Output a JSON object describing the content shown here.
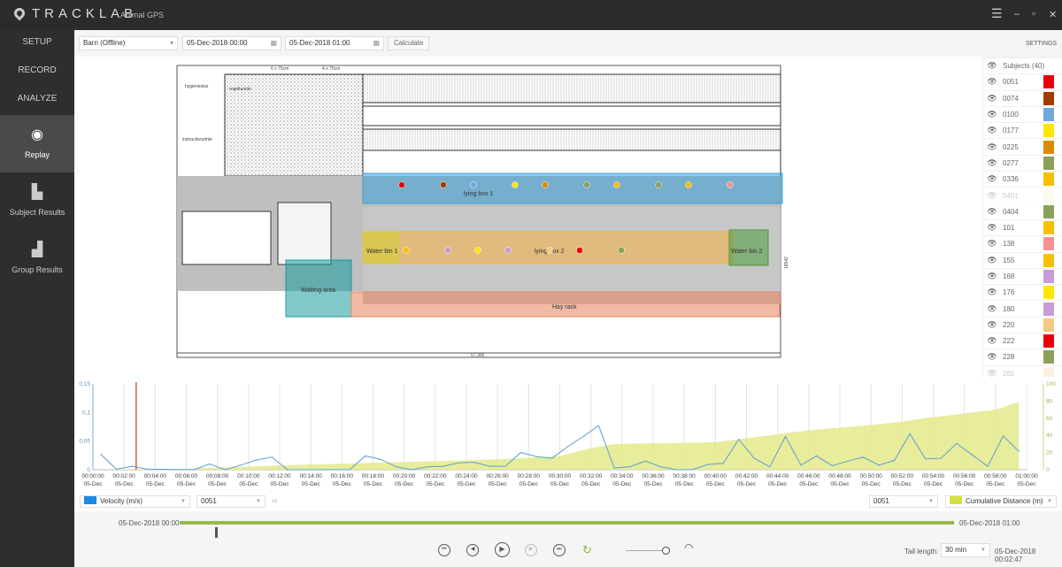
{
  "app": {
    "title": "TRACKLAB",
    "subtitle": "Animal GPS",
    "window_controls": [
      "menu-icon",
      "minimize-icon",
      "restore-icon",
      "close-icon"
    ]
  },
  "sidebar": {
    "items": [
      {
        "label": "SETUP"
      },
      {
        "label": "RECORD"
      },
      {
        "label": "ANALYZE"
      }
    ],
    "tools": [
      {
        "label": "Replay",
        "icon": "replay-icon",
        "active": true
      },
      {
        "label": "Subject Results",
        "icon": "subject-results-icon"
      },
      {
        "label": "Group Results",
        "icon": "group-results-icon"
      }
    ]
  },
  "toolbar": {
    "source": "Barn (Offline)",
    "start": "05-Dec-2018 00:00",
    "end": "05-Dec-2018 01:00",
    "calculate": "Calculate",
    "settings": "SETTINGS"
  },
  "map": {
    "zones": [
      {
        "label": "lying box 1",
        "color": "#3aa0d8"
      },
      {
        "label": "lying box 2",
        "color": "#f5b041"
      },
      {
        "label": "Water bin 1",
        "color": "#d4d030"
      },
      {
        "label": "Water bin 2",
        "color": "#4a9a3a"
      },
      {
        "label": "Waiting area",
        "color": "#1a9aa0"
      },
      {
        "label": "Hay rack",
        "color": "#e8825a"
      }
    ],
    "labels": {
      "room1": "hygieneslus",
      "room2": "regeltumtle",
      "room3": "instructieruimte",
      "dim_top1": "6 x 75cm",
      "dim_top2": "4 x 75cm",
      "dim_bottom": "57,300",
      "dim_right": "18542"
    }
  },
  "subjects": {
    "header": "Subjects (40)",
    "items": [
      {
        "id": "0051",
        "color": "#e8000b"
      },
      {
        "id": "0074",
        "color": "#a33a00"
      },
      {
        "id": "0100",
        "color": "#6fa8dc"
      },
      {
        "id": "0177",
        "color": "#ffe600"
      },
      {
        "id": "0225",
        "color": "#d98c00"
      },
      {
        "id": "0277",
        "color": "#8aa05a"
      },
      {
        "id": "0336",
        "color": "#f5c000"
      },
      {
        "id": "0401",
        "color": "#eef5c8",
        "hidden": true
      },
      {
        "id": "0404",
        "color": "#8aa05a"
      },
      {
        "id": "101",
        "color": "#f5c000"
      },
      {
        "id": "138",
        "color": "#f89090"
      },
      {
        "id": "155",
        "color": "#f5c000"
      },
      {
        "id": "168",
        "color": "#c89ad8"
      },
      {
        "id": "176",
        "color": "#ffe600"
      },
      {
        "id": "180",
        "color": "#c89ad8"
      },
      {
        "id": "220",
        "color": "#f8c880"
      },
      {
        "id": "222",
        "color": "#e8000b"
      },
      {
        "id": "228",
        "color": "#8aa05a"
      },
      {
        "id": "285",
        "color": "#f8d8a0",
        "hidden": true
      }
    ]
  },
  "chart_data": {
    "type": "line",
    "x_ticks": [
      "00:00:00",
      "00:02:00",
      "00:04:00",
      "00:06:00",
      "00:08:00",
      "00:10:00",
      "00:12:00",
      "00:14:00",
      "00:16:00",
      "00:18:00",
      "00:20:00",
      "00:22:00",
      "00:24:00",
      "00:26:00",
      "00:28:00",
      "00:30:00",
      "00:32:00",
      "00:34:00",
      "00:36:00",
      "00:38:00",
      "00:40:00",
      "00:42:00",
      "00:44:00",
      "00:46:00",
      "00:48:00",
      "00:50:00",
      "00:52:00",
      "00:54:00",
      "00:56:00",
      "00:58:00",
      "01:00:00"
    ],
    "x_tick_date": "05-Dec",
    "xlim_minutes": [
      0,
      60
    ],
    "y_left": {
      "ticks": [
        "0",
        "0,05",
        "0,1",
        "0,15"
      ],
      "range": [
        0,
        0.15
      ]
    },
    "y_right": {
      "ticks": [
        "0",
        "20",
        "40",
        "60",
        "80",
        "100"
      ],
      "range": [
        0,
        100
      ]
    },
    "cursor_minute": 2.78,
    "series": [
      {
        "name": "Velocity (m/s)",
        "axis": "left",
        "color": "#5a9fd4",
        "type": "line",
        "x": [
          0.5,
          1.5,
          2.5,
          3.5,
          6.5,
          7.5,
          8.5,
          9.5,
          10.5,
          11.5,
          12.5,
          16.5,
          17.5,
          18.5,
          19.5,
          20.5,
          21.5,
          22.5,
          23.5,
          24.5,
          25.5,
          26.5,
          27.5,
          28.5,
          29.5,
          30.5,
          31.5,
          32.5,
          33.5,
          34.5,
          35.5,
          36.5,
          37.5,
          38.5,
          39.5,
          40.5,
          41.5,
          42.5,
          43.5,
          44.5,
          45.5,
          46.5,
          47.5,
          48.5,
          49.5,
          50.5,
          51.5,
          52.5,
          53.5,
          54.5,
          55.5,
          56.5,
          57.5,
          58.5,
          59.5
        ],
        "y": [
          0.027,
          0.001,
          0.006,
          0.001,
          0,
          0.01,
          0,
          0.008,
          0.017,
          0.022,
          0,
          0,
          0.024,
          0.018,
          0.005,
          0,
          0.005,
          0.006,
          0.012,
          0.013,
          0.006,
          0.006,
          0.03,
          0.023,
          0.02,
          0.04,
          0.058,
          0.077,
          0.003,
          0.005,
          0.015,
          0.005,
          0,
          0,
          0.009,
          0.011,
          0.053,
          0.02,
          0.005,
          0.058,
          0.008,
          0.024,
          0.007,
          0.015,
          0.022,
          0.008,
          0.016,
          0.063,
          0.019,
          0.02,
          0.046,
          0.026,
          0.006,
          0.059,
          0.032
        ]
      },
      {
        "name": "Cumulative Distance (m)",
        "axis": "right",
        "color": "#e4ea8a",
        "type": "area",
        "x": [
          0,
          6,
          12,
          18,
          26,
          30,
          32,
          33.5,
          40,
          43,
          46,
          50,
          52,
          53.5,
          58,
          59.5
        ],
        "y": [
          0,
          1,
          5,
          8,
          12,
          16,
          25,
          30,
          32,
          39,
          46,
          52,
          56,
          60,
          70,
          79
        ]
      }
    ]
  },
  "chart_controls": {
    "left_metric": "Velocity (m/s)",
    "left_subject": "0051",
    "right_subject": "0051",
    "right_metric": "Cumulative Distance (m)",
    "left_color": "#1e88e5",
    "right_color": "#d8e040"
  },
  "timeline": {
    "start": "05-Dec-2018 00:00",
    "end": "05-Dec-2018 01:00",
    "position": 0.0464,
    "tail_label": "Tail length:",
    "tail_value": "30 min",
    "current_time": "05-Dec-2018 00:02:47",
    "speed": 0.9
  }
}
